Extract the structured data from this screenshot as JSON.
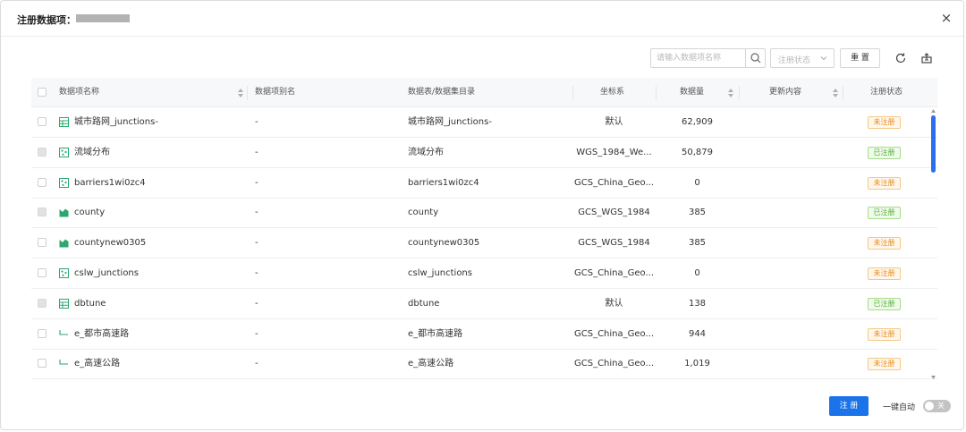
{
  "dialog": {
    "title": "注册数据项：",
    "close_glyph": "×"
  },
  "toolbar": {
    "search_placeholder": "请输入数据项名称",
    "status_filter_placeholder": "注册状态",
    "reset_label": "重 置"
  },
  "table": {
    "headers": {
      "name": "数据项名称",
      "alias": "数据项别名",
      "source": "数据表/数据集目录",
      "crs": "坐标系",
      "count": "数据量",
      "update": "更新内容",
      "status": "注册状态"
    },
    "rows": [
      {
        "type_icon": "table-icon",
        "name": "城市路网_junctions-",
        "alias": "-",
        "source": "城市路网_junctions-",
        "crs": "默认",
        "count": "62,909",
        "status": "未注册",
        "registered": false
      },
      {
        "type_icon": "point-icon",
        "name": "流域分布",
        "alias": "-",
        "source": "流域分布",
        "crs": "WGS_1984_We...",
        "count": "50,879",
        "status": "已注册",
        "registered": true
      },
      {
        "type_icon": "point-icon",
        "name": "barriers1wi0zc4",
        "alias": "-",
        "source": "barriers1wi0zc4",
        "crs": "GCS_China_Geo...",
        "count": "0",
        "status": "未注册",
        "registered": false
      },
      {
        "type_icon": "polygon-icon",
        "name": "county",
        "alias": "-",
        "source": "county",
        "crs": "GCS_WGS_1984",
        "count": "385",
        "status": "已注册",
        "registered": true
      },
      {
        "type_icon": "polygon-icon",
        "name": "countynew0305",
        "alias": "-",
        "source": "countynew0305",
        "crs": "GCS_WGS_1984",
        "count": "385",
        "status": "未注册",
        "registered": false
      },
      {
        "type_icon": "point-icon",
        "name": "cslw_junctions",
        "alias": "-",
        "source": "cslw_junctions",
        "crs": "GCS_China_Geo...",
        "count": "0",
        "status": "未注册",
        "registered": false
      },
      {
        "type_icon": "table-icon",
        "name": "dbtune",
        "alias": "-",
        "source": "dbtune",
        "crs": "默认",
        "count": "138",
        "status": "已注册",
        "registered": true
      },
      {
        "type_icon": "line-icon",
        "name": "e_都市高速路",
        "alias": "-",
        "source": "e_都市高速路",
        "crs": "GCS_China_Geo...",
        "count": "944",
        "status": "未注册",
        "registered": false
      },
      {
        "type_icon": "line-icon",
        "name": "e_高速公路",
        "alias": "-",
        "source": "e_高速公路",
        "crs": "GCS_China_Geo...",
        "count": "1,019",
        "status": "未注册",
        "registered": false
      }
    ]
  },
  "footer": {
    "register_label": "注 册",
    "auto_label": "一键自动",
    "toggle_state": "关"
  },
  "colors": {
    "primary": "#1a73e8",
    "unregistered": "#e88a1a",
    "registered": "#52b030",
    "icon_green": "#2aa86f"
  }
}
